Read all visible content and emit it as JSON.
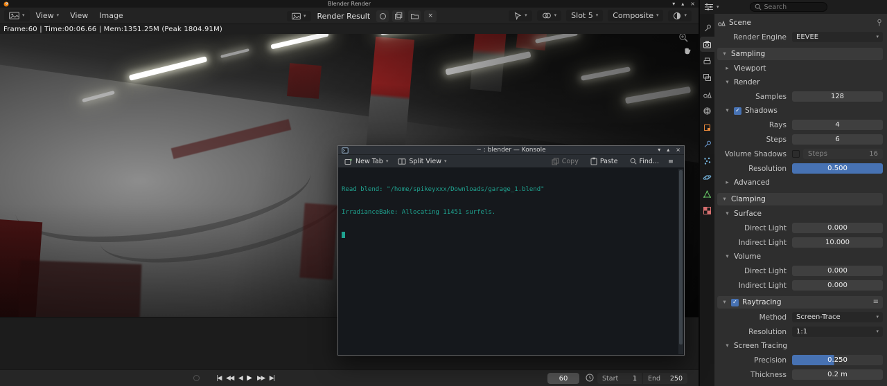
{
  "icons": {
    "caret": "▾",
    "collapsed": "▸",
    "expanded": "▾",
    "check": "✓",
    "close": "×",
    "min": "▾",
    "max": "▴",
    "menu": "≡",
    "jump_start": "|◀",
    "prev_key": "◀◀",
    "play_rev": "◀",
    "play": "▶",
    "next_key": "▶▶",
    "jump_end": "▶|"
  },
  "window": {
    "title": "Blender Render"
  },
  "menubar": {
    "mode_label": "View",
    "menu_view": "View",
    "menu_image": "Image",
    "datablock_name": "Render Result",
    "slot_label": "Slot 5",
    "pass_label": "Composite"
  },
  "status_text": "Frame:60 | Time:00:06.66 | Mem:1351.25M (Peak 1804.91M)",
  "playbar": {
    "frame_current": "60",
    "start_label": "Start",
    "start_value": "1",
    "end_label": "End",
    "end_value": "250"
  },
  "terminal": {
    "title": "~ : blender — Konsole",
    "tab_new": "New Tab",
    "tab_split": "Split View",
    "btn_copy": "Copy",
    "btn_paste": "Paste",
    "btn_find": "Find...",
    "line1": "Read blend: \"/home/spikeyxxx/Downloads/garage_1.blend\"",
    "line2": "IrradianceBake: Allocating 11451 surfels."
  },
  "properties": {
    "search_placeholder": "Search",
    "breadcrumb": "Scene",
    "render_engine": {
      "label": "Render Engine",
      "value": "EEVEE"
    },
    "sampling": {
      "title": "Sampling",
      "viewport_title": "Viewport",
      "render_title": "Render",
      "samples_label": "Samples",
      "samples_value": "128",
      "shadows_title": "Shadows",
      "rays_label": "Rays",
      "rays_value": "4",
      "steps_label": "Steps",
      "steps_value": "6",
      "volume_shadows_label": "Volume Shadows",
      "volume_steps_label": "Steps",
      "volume_steps_value": "16",
      "resolution_label": "Resolution",
      "resolution_value": "0.500",
      "advanced_title": "Advanced"
    },
    "clamping": {
      "title": "Clamping",
      "surface_title": "Surface",
      "surface_direct_label": "Direct Light",
      "surface_direct_value": "0.000",
      "surface_indirect_label": "Indirect Light",
      "surface_indirect_value": "10.000",
      "volume_title": "Volume",
      "volume_direct_label": "Direct Light",
      "volume_direct_value": "0.000",
      "volume_indirect_label": "Indirect Light",
      "volume_indirect_value": "0.000"
    },
    "raytracing": {
      "title": "Raytracing",
      "method_label": "Method",
      "method_value": "Screen-Trace",
      "resolution_label": "Resolution",
      "resolution_value": "1:1",
      "screen_tracing_title": "Screen Tracing",
      "precision_label": "Precision",
      "precision_value": "0.250",
      "thickness_label": "Thickness",
      "thickness_value": "0.2 m"
    }
  }
}
